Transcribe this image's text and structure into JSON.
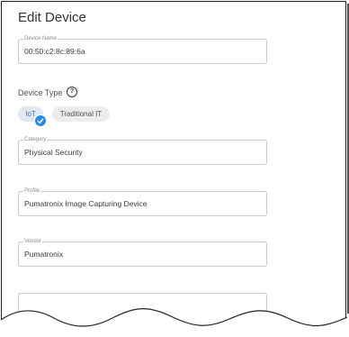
{
  "dialog": {
    "title": "Edit Device"
  },
  "fields": {
    "device_name": {
      "label": "Device Name",
      "value": "00:50:c2:8c:89:6a"
    },
    "category": {
      "label": "Category",
      "value": "Physical Security"
    },
    "profile": {
      "label": "Profile",
      "value": "Pumatronix Image Capturing Device"
    },
    "vendor": {
      "label": "Vendor",
      "value": "Pumatronix"
    }
  },
  "device_type": {
    "label": "Device Type",
    "help_icon": "question-circle-icon",
    "options": [
      {
        "label": "IoT",
        "selected": true
      },
      {
        "label": "Traditional IT",
        "selected": false
      }
    ]
  },
  "colors": {
    "accent": "#2a8ae0",
    "chip_selected_bg": "#e1e8f2",
    "chip_bg": "#ececec",
    "field_border": "#c9c9c9"
  }
}
